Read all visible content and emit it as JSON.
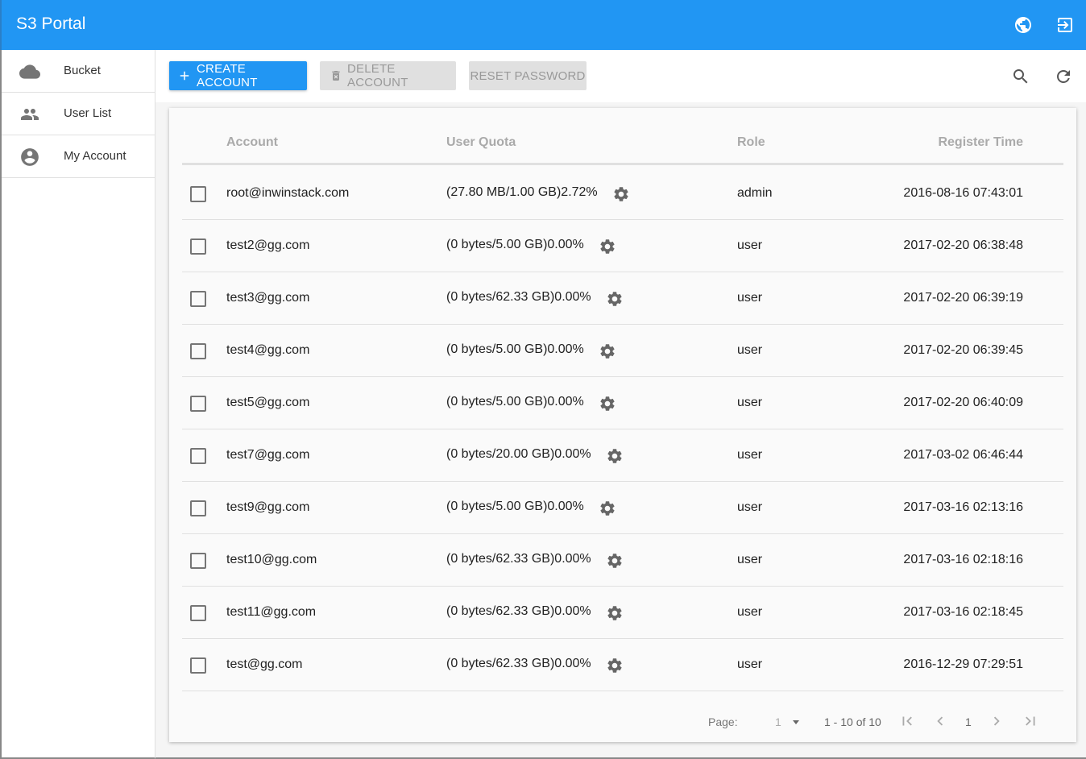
{
  "app": {
    "title": "S3 Portal",
    "header_icons": [
      "globe-icon",
      "logout-icon"
    ],
    "brand_color": "#2196f3"
  },
  "sidebar": {
    "items": [
      {
        "label": "Bucket",
        "icon": "cloud-icon"
      },
      {
        "label": "User List",
        "icon": "people-icon"
      },
      {
        "label": "My Account",
        "icon": "account-circle-icon"
      }
    ]
  },
  "toolbar": {
    "create_label": "CREATE ACCOUNT",
    "delete_label": "DELETE ACCOUNT",
    "reset_label": "RESET PASSWORD",
    "search_icon": "search-icon",
    "refresh_icon": "refresh-icon"
  },
  "table": {
    "columns": [
      "Account",
      "User Quota",
      "Role",
      "Register Time"
    ],
    "rows": [
      {
        "account": "root@inwinstack.com",
        "quota": "(27.80 MB/1.00 GB)2.72%",
        "role": "admin",
        "time": "2016-08-16 07:43:01"
      },
      {
        "account": "test2@gg.com",
        "quota": "(0 bytes/5.00 GB)0.00%",
        "role": "user",
        "time": "2017-02-20 06:38:48"
      },
      {
        "account": "test3@gg.com",
        "quota": "(0 bytes/62.33 GB)0.00%",
        "role": "user",
        "time": "2017-02-20 06:39:19"
      },
      {
        "account": "test4@gg.com",
        "quota": "(0 bytes/5.00 GB)0.00%",
        "role": "user",
        "time": "2017-02-20 06:39:45"
      },
      {
        "account": "test5@gg.com",
        "quota": "(0 bytes/5.00 GB)0.00%",
        "role": "user",
        "time": "2017-02-20 06:40:09"
      },
      {
        "account": "test7@gg.com",
        "quota": "(0 bytes/20.00 GB)0.00%",
        "role": "user",
        "time": "2017-03-02 06:46:44"
      },
      {
        "account": "test9@gg.com",
        "quota": "(0 bytes/5.00 GB)0.00%",
        "role": "user",
        "time": "2017-03-16 02:13:16"
      },
      {
        "account": "test10@gg.com",
        "quota": "(0 bytes/62.33 GB)0.00%",
        "role": "user",
        "time": "2017-03-16 02:18:16"
      },
      {
        "account": "test11@gg.com",
        "quota": "(0 bytes/62.33 GB)0.00%",
        "role": "user",
        "time": "2017-03-16 02:18:45"
      },
      {
        "account": "test@gg.com",
        "quota": "(0 bytes/62.33 GB)0.00%",
        "role": "user",
        "time": "2016-12-29 07:29:51"
      }
    ]
  },
  "pagination": {
    "page_label": "Page:",
    "page_select_value": "1",
    "range_text": "1 - 10 of 10",
    "current_page": "1"
  }
}
